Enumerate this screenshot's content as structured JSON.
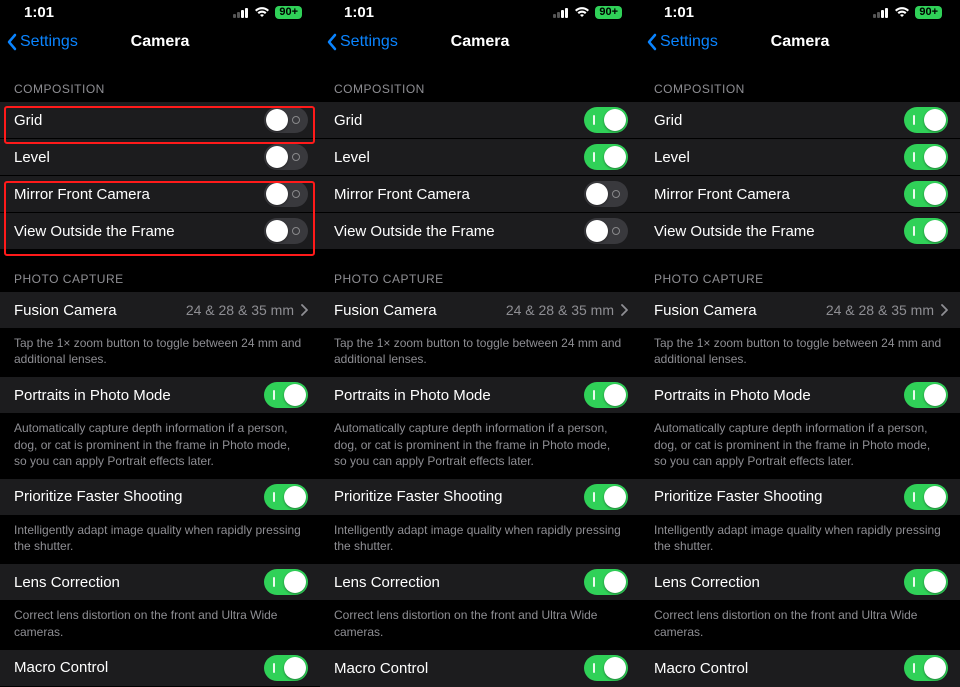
{
  "common": {
    "time": "1:01",
    "battery": "90+",
    "back_label": "Settings",
    "title": "Camera",
    "section_composition": "COMPOSITION",
    "section_photo_capture": "PHOTO CAPTURE",
    "row_grid": "Grid",
    "row_level": "Level",
    "row_mirror": "Mirror Front Camera",
    "row_view_outside": "View Outside the Frame",
    "row_fusion": "Fusion Camera",
    "row_fusion_value": "24 & 28 & 35 mm",
    "footer_fusion": "Tap the 1× zoom button to toggle between 24 mm and additional lenses.",
    "row_portraits": "Portraits in Photo Mode",
    "footer_portraits": "Automatically capture depth information if a person, dog, or cat is prominent in the frame in Photo mode, so you can apply Portrait effects later.",
    "row_prioritize": "Prioritize Faster Shooting",
    "footer_prioritize": "Intelligently adapt image quality when rapidly pressing the shutter.",
    "row_lens": "Lens Correction",
    "footer_lens": "Correct lens distortion on the front and Ultra Wide cameras.",
    "row_macro": "Macro Control"
  },
  "screens": {
    "left": {
      "toggles": {
        "grid": false,
        "level": false,
        "mirror": false,
        "view_outside": false,
        "portraits": true,
        "prioritize": true,
        "lens": true
      }
    },
    "middle": {
      "toggles": {
        "grid": true,
        "level": true,
        "mirror": false,
        "view_outside": false,
        "portraits": true,
        "prioritize": true,
        "lens": true
      }
    },
    "right": {
      "toggles": {
        "grid": true,
        "level": true,
        "mirror": true,
        "view_outside": true,
        "portraits": true,
        "prioritize": true,
        "lens": true
      }
    }
  }
}
